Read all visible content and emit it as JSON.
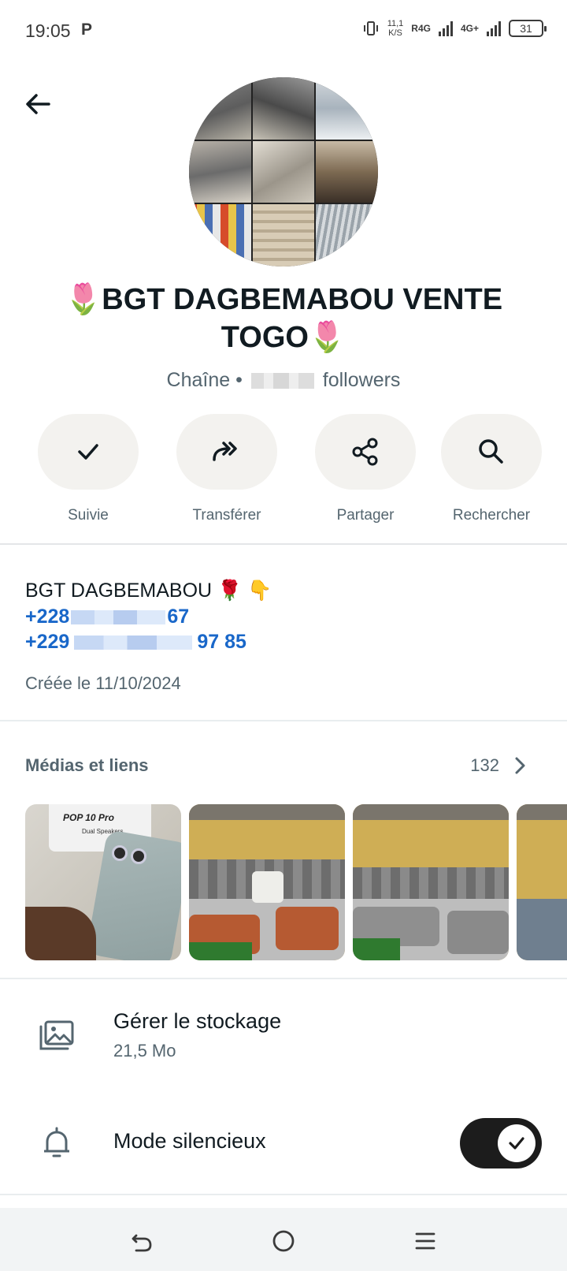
{
  "status_bar": {
    "time": "19:05",
    "app_indicator": "P",
    "net_speed_value": "11,1",
    "net_speed_unit": "K/S",
    "sim1_label": "R4G",
    "sim2_label": "4G+",
    "battery": "31"
  },
  "header": {
    "back_icon": "arrow-left-icon",
    "title": "🌷BGT DAGBEMABOU VENTE TOGO🌷",
    "subtitle_prefix": "Chaîne •",
    "subtitle_suffix": "followers"
  },
  "actions": [
    {
      "label": "Suivie",
      "icon": "check-icon"
    },
    {
      "label": "Transférer",
      "icon": "forward-icon"
    },
    {
      "label": "Partager",
      "icon": "share-icon"
    },
    {
      "label": "Rechercher",
      "icon": "search-icon"
    }
  ],
  "description": {
    "name": "BGT DAGBEMABOU 🌹 👇",
    "phone1_start": "+228",
    "phone1_end": "67",
    "phone2_start": "+229",
    "phone2_end": "97 85",
    "created": "Créée le 11/10/2024"
  },
  "media": {
    "heading": "Médias et liens",
    "count": "132",
    "thumb1_text1": "POP 10 Pro",
    "thumb1_text2": "Dual Speakers"
  },
  "storage": {
    "title": "Gérer le stockage",
    "size": "21,5 Mo"
  },
  "silent_mode": {
    "title": "Mode silencieux",
    "enabled": true
  },
  "colors": {
    "accent_link": "#1967c9",
    "toggle_on": "#1c1c1c"
  }
}
